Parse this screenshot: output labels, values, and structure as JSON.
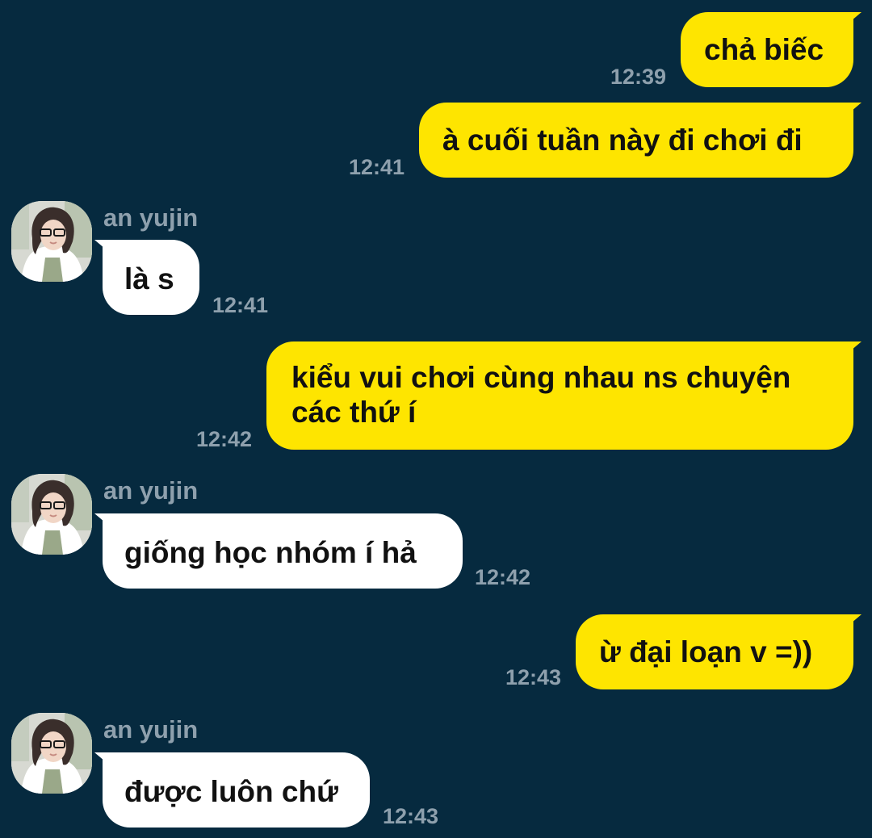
{
  "contact": {
    "name": "an yujin"
  },
  "messages": [
    {
      "direction": "outgoing",
      "text": "chả biếc",
      "time": "12:39"
    },
    {
      "direction": "outgoing",
      "text": "à cuối tuần này đi chơi đi",
      "time": "12:41"
    },
    {
      "direction": "incoming",
      "sender": "an yujin",
      "text": "là s",
      "time": "12:41"
    },
    {
      "direction": "outgoing",
      "lines": [
        "kiểu vui chơi cùng nhau ns chuyện",
        "các thứ í"
      ],
      "time": "12:42"
    },
    {
      "direction": "incoming",
      "sender": "an yujin",
      "text": "giống học nhóm í hả",
      "time": "12:42"
    },
    {
      "direction": "outgoing",
      "text": "ừ đại loạn v =))",
      "time": "12:43"
    },
    {
      "direction": "incoming",
      "sender": "an yujin",
      "text": "được luôn chứ",
      "time": "12:43"
    }
  ],
  "colors": {
    "background": "#062a3f",
    "outgoing_bubble": "#fee500",
    "incoming_bubble": "#ffffff",
    "meta_text": "#8ea0ad",
    "message_text": "#111111"
  }
}
